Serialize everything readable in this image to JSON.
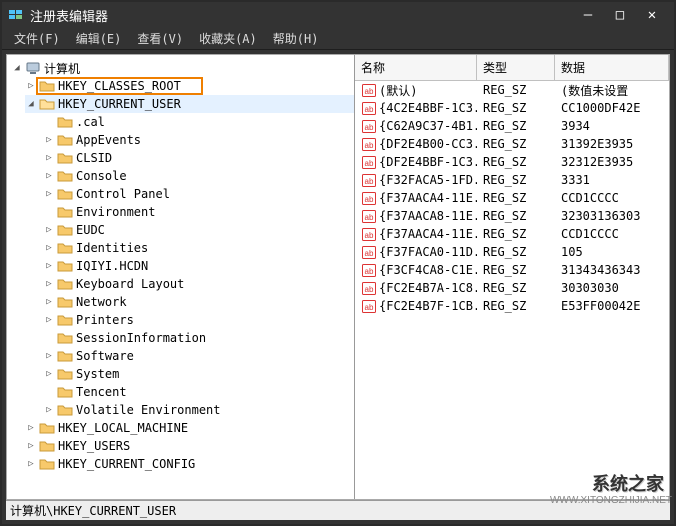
{
  "title": "注册表编辑器",
  "menu": [
    "文件(F)",
    "编辑(E)",
    "查看(V)",
    "收藏夹(A)",
    "帮助(H)"
  ],
  "tree": {
    "root": "计算机",
    "hives": [
      "HKEY_CLASSES_ROOT",
      "HKEY_CURRENT_USER",
      "HKEY_LOCAL_MACHINE",
      "HKEY_USERS",
      "HKEY_CURRENT_CONFIG"
    ],
    "hkcu_children": [
      ".cal",
      "AppEvents",
      "CLSID",
      "Console",
      "Control Panel",
      "Environment",
      "EUDC",
      "Identities",
      "IQIYI.HCDN",
      "Keyboard Layout",
      "Network",
      "Printers",
      "SessionInformation",
      "Software",
      "System",
      "Tencent",
      "Volatile Environment"
    ]
  },
  "list": {
    "headers": {
      "name": "名称",
      "type": "类型",
      "data": "数据"
    },
    "rows": [
      {
        "icon": "str",
        "name": "(默认)",
        "type": "REG_SZ",
        "data": "(数值未设置"
      },
      {
        "icon": "str",
        "name": "{4C2E4BBF-1C3...",
        "type": "REG_SZ",
        "data": "CC1000DF42E"
      },
      {
        "icon": "str",
        "name": "{C62A9C37-4B1...",
        "type": "REG_SZ",
        "data": "3934"
      },
      {
        "icon": "str",
        "name": "{DF2E4B00-CC3...",
        "type": "REG_SZ",
        "data": "31392E3935"
      },
      {
        "icon": "str",
        "name": "{DF2E4BBF-1C3...",
        "type": "REG_SZ",
        "data": "32312E3935"
      },
      {
        "icon": "str",
        "name": "{F32FACA5-1FD...",
        "type": "REG_SZ",
        "data": "3331"
      },
      {
        "icon": "str",
        "name": "{F37AACA4-11E...",
        "type": "REG_SZ",
        "data": "CCD1CCCC"
      },
      {
        "icon": "str",
        "name": "{F37AACA8-11E...",
        "type": "REG_SZ",
        "data": "32303136303"
      },
      {
        "icon": "str",
        "name": "{F37AACA4-11E...",
        "type": "REG_SZ",
        "data": "CCD1CCCC"
      },
      {
        "icon": "str",
        "name": "{F37FACA0-11D...",
        "type": "REG_SZ",
        "data": "105"
      },
      {
        "icon": "str",
        "name": "{F3CF4CA8-C1E...",
        "type": "REG_SZ",
        "data": "31343436343"
      },
      {
        "icon": "str",
        "name": "{FC2E4B7A-1C8...",
        "type": "REG_SZ",
        "data": "30303030"
      },
      {
        "icon": "str",
        "name": "{FC2E4B7F-1CB...",
        "type": "REG_SZ",
        "data": "E53FF00042E"
      }
    ]
  },
  "status": "计算机\\HKEY_CURRENT_USER",
  "watermark": {
    "logo": "系统之家",
    "url": "WWW.XITONGZHIJIA.NET"
  }
}
